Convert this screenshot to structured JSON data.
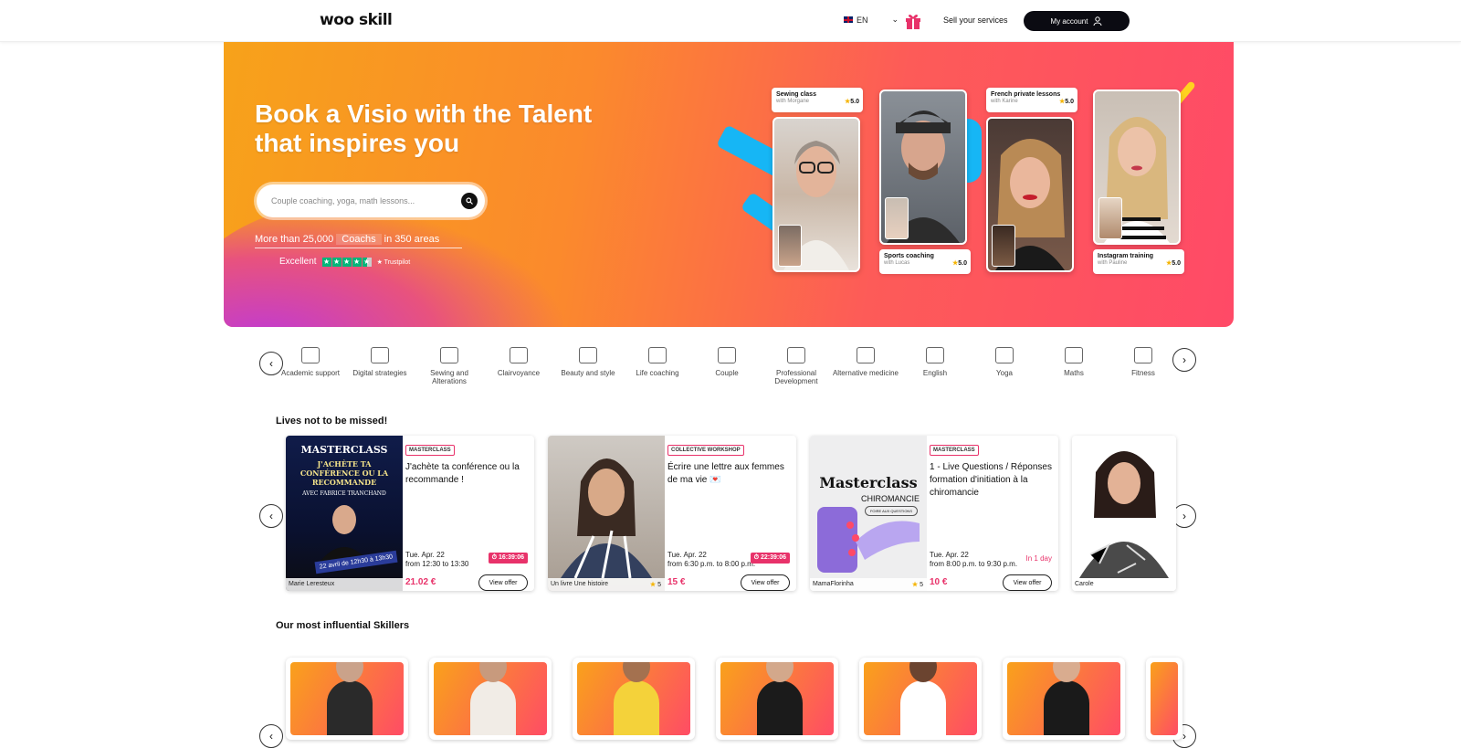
{
  "header": {
    "logo": "woo skill",
    "language": "EN",
    "sell_label": "Sell your services",
    "account_label": "My account"
  },
  "hero": {
    "title": "Book a Visio with the Talent that inspires you",
    "search_placeholder": "Couple coaching, yoga, math lessons...",
    "stats": {
      "prefix": "More than 25,000",
      "middle": "Coachs",
      "suffix": "in 350 areas"
    },
    "trust_label": "Excellent",
    "trust_brand": "Trustpilot",
    "videos": [
      {
        "title": "Sewing class",
        "with": "with Morgane",
        "rating": "5.0"
      },
      {
        "title": "Sports coaching",
        "with": "with Lucas",
        "rating": "5.0"
      },
      {
        "title": "French private lessons",
        "with": "with Karine",
        "rating": "5.0"
      },
      {
        "title": "Instagram training",
        "with": "with Pauline",
        "rating": "5.0"
      }
    ]
  },
  "categories": [
    {
      "label": "Academic support",
      "icon": "books-icon"
    },
    {
      "label": "Digital strategies",
      "icon": "digital-icon"
    },
    {
      "label": "Sewing and Alterations",
      "icon": "sewing-machine-icon"
    },
    {
      "label": "Clairvoyance",
      "icon": "crystal-ball-icon"
    },
    {
      "label": "Beauty and style",
      "icon": "brushes-icon"
    },
    {
      "label": "Life coaching",
      "icon": "handshake-icon"
    },
    {
      "label": "Couple",
      "icon": "couple-icon"
    },
    {
      "label": "Professional Development",
      "icon": "laptop-icon"
    },
    {
      "label": "Alternative medicine",
      "icon": "mortar-icon"
    },
    {
      "label": "English",
      "icon": "uk-flag-icon"
    },
    {
      "label": "Yoga",
      "icon": "yoga-icon"
    },
    {
      "label": "Maths",
      "icon": "calculator-icon"
    },
    {
      "label": "Fitness",
      "icon": "dumbbell-icon"
    }
  ],
  "lives": {
    "heading": "Lives not to be missed!",
    "items": [
      {
        "badge": "MASTERCLASS",
        "title": "J'achète ta conférence ou la recommande !",
        "date": "Tue. Apr. 22",
        "time": "from 12:30 to 13:30",
        "status": "16:39:06",
        "price": "21.02 €",
        "offer": "View offer",
        "host": "Marie Leresteux",
        "rating": "",
        "poster": {
          "l1": "MASTERCLASS",
          "l2": "J'ACHÈTE TA CONFÉRENCE OU LA RECOMMANDE",
          "l3": "AVEC FABRICE TRANCHAND",
          "l4": "22 avril de 12h30 à 13h30"
        }
      },
      {
        "badge": "COLLECTIVE WORKSHOP",
        "title": "Écrire une lettre aux femmes de ma vie 💌",
        "date": "Tue. Apr. 22",
        "time": "from 6:30 p.m. to 8:00 p.m.",
        "status": "22:39:06",
        "price": "15 €",
        "offer": "View offer",
        "host": "Un livre Une histoire",
        "rating": "5"
      },
      {
        "badge": "MASTERCLASS",
        "title": "1 - Live Questions / Réponses formation d'initiation à la chiromancie",
        "date": "Tue. Apr. 22",
        "time": "from 8:00 p.m. to 9:30 p.m.",
        "status": "In 1 day",
        "price": "10 €",
        "offer": "View offer",
        "host": "MamaFlorinha",
        "rating": "5",
        "poster": {
          "l1": "Masterclass",
          "l2": "CHIROMANCIE",
          "l3": "FOIRE AUX QUESTIONS"
        }
      },
      {
        "host": "Carole"
      }
    ]
  },
  "skillers": {
    "heading": "Our most influential Skillers"
  }
}
